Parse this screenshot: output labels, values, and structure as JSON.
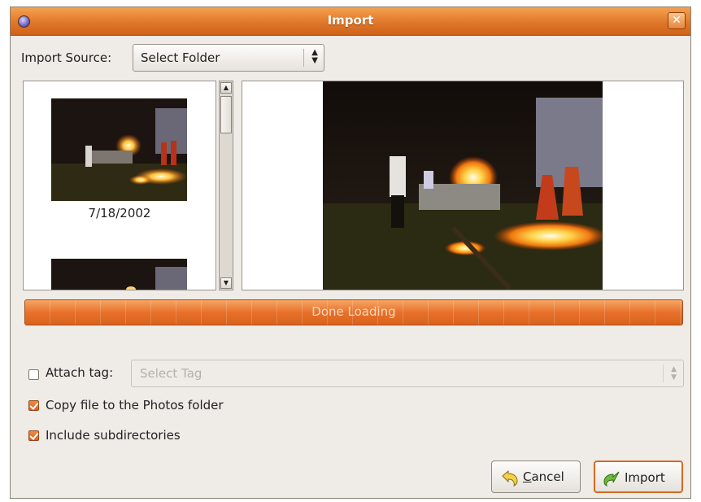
{
  "window": {
    "title": "Import"
  },
  "source": {
    "label": "Import Source:",
    "value": "Select Folder"
  },
  "thumbnails": [
    {
      "date": "7/18/2002"
    }
  ],
  "progress": {
    "text": "Done Loading",
    "fraction": 1.0
  },
  "options": {
    "attach_tag": {
      "label": "Attach tag:",
      "checked": false,
      "placeholder": "Select Tag"
    },
    "copy_file": {
      "label": "Copy file to the Photos folder",
      "checked": true
    },
    "include_subdirs": {
      "label": "Include subdirectories",
      "checked": true
    }
  },
  "buttons": {
    "cancel": {
      "mnemonic": "C",
      "rest": "ancel"
    },
    "import": {
      "label": "Import"
    }
  },
  "colors": {
    "accent": "#e0772a",
    "window_bg": "#efebe7"
  },
  "icons": {
    "window": "app-icon",
    "close": "close-icon",
    "cancel": "undo-arrow-icon",
    "import": "import-arrow-icon"
  }
}
